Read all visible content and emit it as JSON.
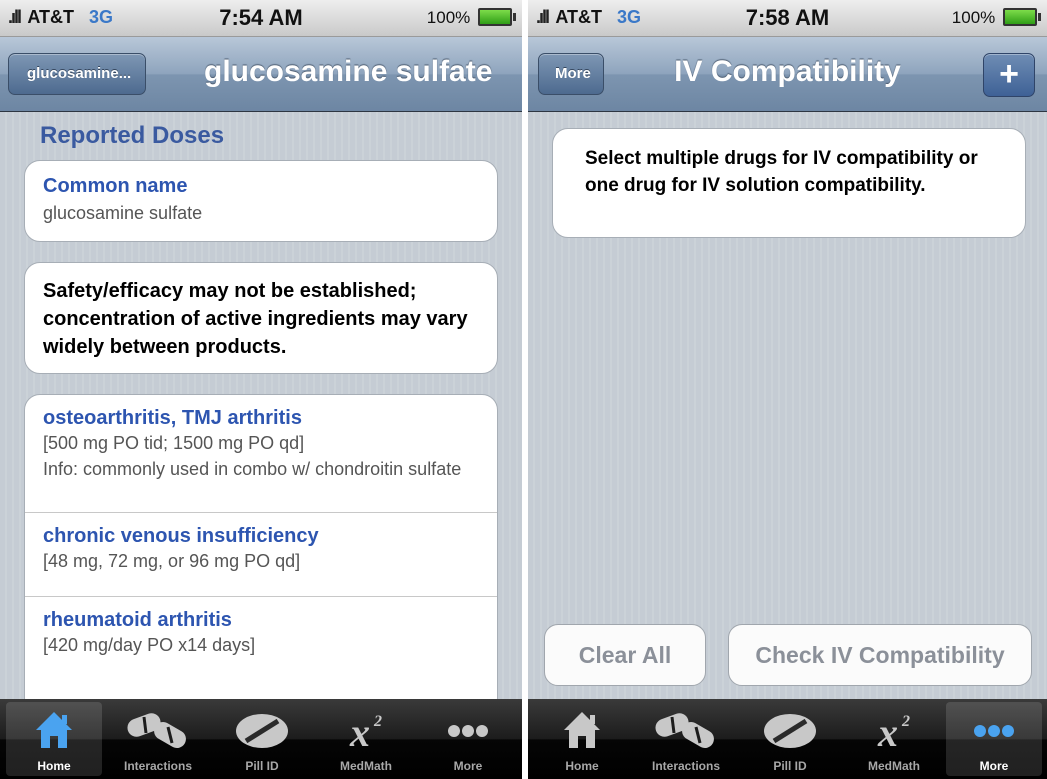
{
  "left": {
    "status": {
      "carrier": "AT&T",
      "network": "3G",
      "time": "7:54 AM",
      "battery": "100%"
    },
    "nav": {
      "back_label": "glucosamine...",
      "title": "glucosamine sulfate"
    },
    "section_header": "Reported Doses",
    "common_name": {
      "label": "Common name",
      "value": "glucosamine sulfate"
    },
    "warning": "Safety/efficacy may not be established; concentration of active ingredients may vary widely between products.",
    "doses": [
      {
        "title": "osteoarthritis, TMJ arthritis",
        "dose": "[500 mg PO tid; 1500 mg PO qd]",
        "info": "Info: commonly used in combo w/ chondroitin sulfate"
      },
      {
        "title": "chronic venous insufficiency",
        "dose": "[48 mg, 72 mg, or 96 mg PO qd]"
      },
      {
        "title": "rheumatoid arthritis",
        "dose": "[420 mg/day PO x14 days]"
      }
    ],
    "active_tab": "Home"
  },
  "right": {
    "status": {
      "carrier": "AT&T",
      "network": "3G",
      "time": "7:58 AM",
      "battery": "100%"
    },
    "nav": {
      "back_label": "More",
      "title": "IV Compatibility",
      "add_symbol": "+"
    },
    "instruction": "Select multiple drugs for IV compatibility or one drug for IV solution compatibility.",
    "clear_all_label": "Clear All",
    "check_label": "Check IV Compatibility",
    "active_tab": "More"
  },
  "tabs": [
    {
      "label": "Home",
      "icon": "home-icon"
    },
    {
      "label": "Interactions",
      "icon": "pills-icon"
    },
    {
      "label": "Pill ID",
      "icon": "pill-icon"
    },
    {
      "label": "MedMath",
      "icon": "x-squared-icon"
    },
    {
      "label": "More",
      "icon": "more-icon"
    }
  ],
  "colors": {
    "link_blue": "#2d55b0",
    "nav_blue": "#7d95b0",
    "active_tab_blue": "#4aa3f0"
  }
}
